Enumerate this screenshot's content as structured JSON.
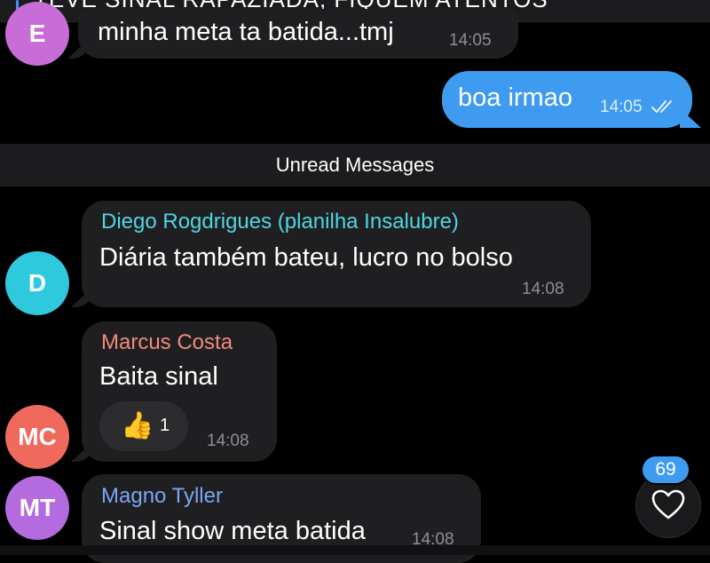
{
  "pinned": {
    "text": "TEVE SINAL RAPAZIADA, FIQUEM ATENTOS"
  },
  "messages": [
    {
      "avatar_initials": "E",
      "avatar_color": "#c86dd7",
      "text": "minha meta ta batida...tmj",
      "time": "14:05"
    },
    {
      "outgoing": true,
      "text": "boa irmao",
      "time": "14:05",
      "status": "read-double-check-icon"
    },
    {
      "avatar_initials": "D",
      "avatar_color": "#2ec9dc",
      "sender": "Diego Rogdrigues (planilha Insalubre)",
      "sender_color": "#4fd6e3",
      "text": "Diária também bateu, lucro no bolso",
      "time": "14:08"
    },
    {
      "avatar_initials": "MC",
      "avatar_color": "#ef6a5d",
      "sender": "Marcus Costa",
      "sender_color": "#ef8a7d",
      "text": "Baita sinal",
      "reaction": {
        "emoji": "👍",
        "count": "1"
      },
      "time": "14:08"
    },
    {
      "avatar_initials": "MT",
      "avatar_color": "#b46be0",
      "sender": "Magno Tyller",
      "sender_color": "#7aa5f5",
      "text": "Sinal show meta batida",
      "time": "14:08"
    }
  ],
  "divider": {
    "label": "Unread Messages"
  },
  "fab": {
    "icon": "heart-icon",
    "badge_count": "69"
  },
  "colors": {
    "background": "#000000",
    "bubble_in": "#1f1f22",
    "bubble_out": "#3f9bf0",
    "timestamp": "#8e8e93"
  }
}
